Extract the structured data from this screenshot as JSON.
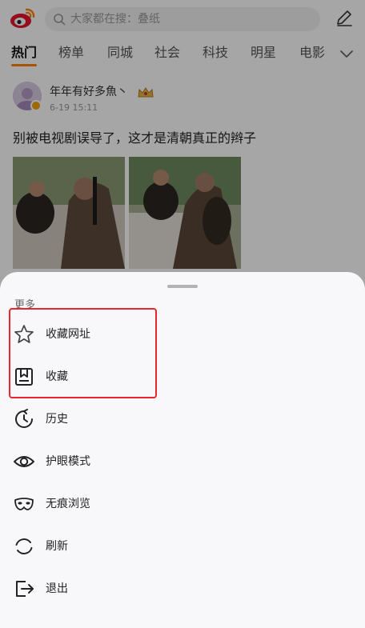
{
  "header": {
    "logo_icon": "weibo-logo-icon",
    "search_placeholder": "大家都在搜：叠纸",
    "edit_icon": "edit-icon"
  },
  "tabs": [
    {
      "label": "热门",
      "active": true
    },
    {
      "label": "榜单"
    },
    {
      "label": "同城"
    },
    {
      "label": "社会"
    },
    {
      "label": "科技"
    },
    {
      "label": "明星"
    },
    {
      "label": "电影"
    }
  ],
  "post": {
    "author": "年年有好多魚丶",
    "time": "6-19 15:11",
    "text": "别被电视剧误导了，这才是清朝真正的辫子"
  },
  "sheet": {
    "title": "更多",
    "items": [
      {
        "label": "收藏网址",
        "icon": "star-icon"
      },
      {
        "label": "收藏",
        "icon": "bookmark-box-icon"
      },
      {
        "label": "历史",
        "icon": "history-clock-icon"
      },
      {
        "label": "护眼模式",
        "icon": "eye-icon"
      },
      {
        "label": "无痕浏览",
        "icon": "mask-icon"
      },
      {
        "label": "刷新",
        "icon": "refresh-icon"
      },
      {
        "label": "退出",
        "icon": "exit-icon"
      }
    ]
  },
  "colors": {
    "accent": "#ff8200",
    "highlight": "#e8262b",
    "sheet_bg": "#f8f8fb"
  }
}
